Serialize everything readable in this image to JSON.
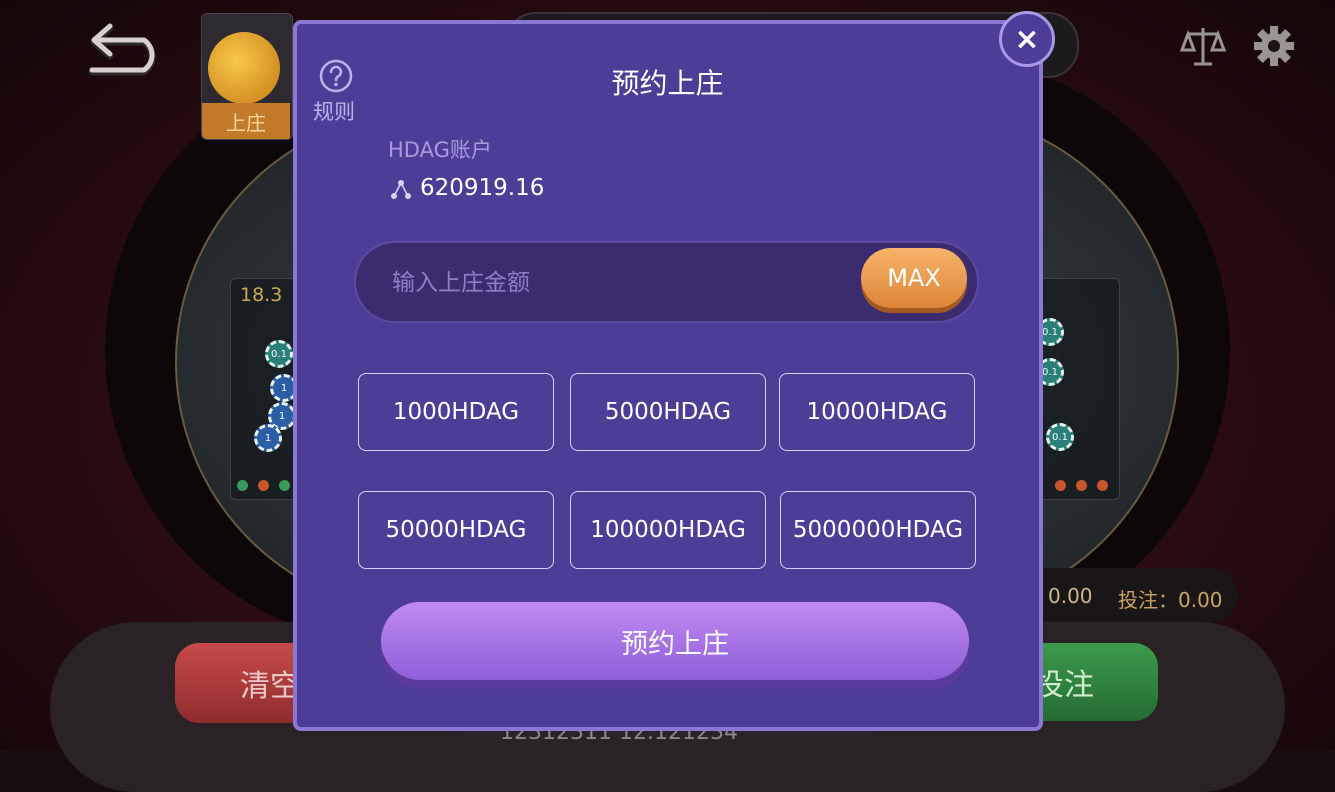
{
  "background": {
    "side_value": "18.3",
    "chips_left": [
      "0.1",
      "1",
      "1",
      "1",
      "1"
    ],
    "chips_right": [
      "0.1",
      "0.1",
      "0.1"
    ],
    "clear_label": "清空",
    "bet_label": "投注",
    "stat_total": "0.00",
    "stat_bet": "投注：0.00",
    "account_id": "12312311 12.121234"
  },
  "avatar": {
    "action_label": "上庄"
  },
  "modal": {
    "title": "预约上庄",
    "help_label": "规则",
    "account_label": "HDAG账户",
    "account_balance": "620919.16",
    "input_placeholder": "输入上庄金额",
    "max_label": "MAX",
    "amounts": [
      "1000HDAG",
      "5000HDAG",
      "10000HDAG",
      "50000HDAG",
      "100000HDAG",
      "5000000HDAG"
    ],
    "confirm_label": "预约上庄",
    "close_label": "×"
  },
  "colors": {
    "modal_bg": "#4e3d97",
    "accent_orange": "#dd8538",
    "confirm_purple": "#a874e8"
  }
}
